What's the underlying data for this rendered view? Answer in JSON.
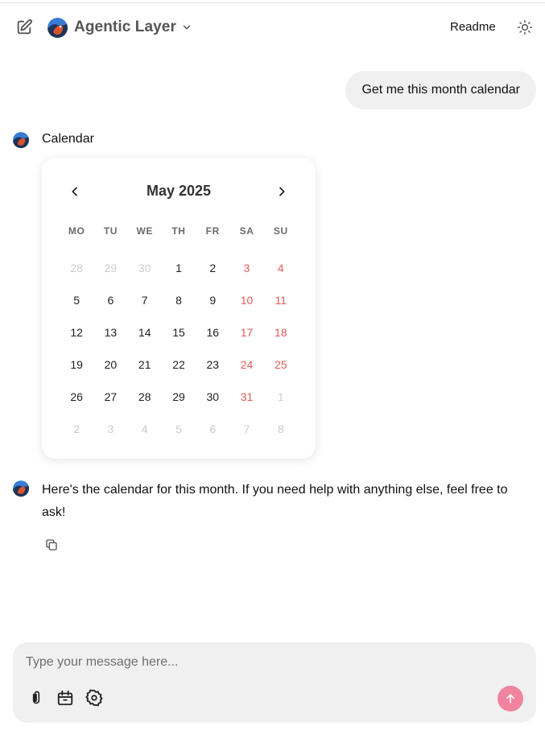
{
  "header": {
    "agent_name": "Agentic Layer",
    "readme_label": "Readme"
  },
  "conversation": {
    "user_message": "Get me this month calendar",
    "assistant_title": "Calendar",
    "assistant_reply": "Here's the calendar for this month. If you need help with anything else, feel free to ask!"
  },
  "calendar": {
    "month_label": "May 2025",
    "weekdays": [
      "MO",
      "TU",
      "WE",
      "TH",
      "FR",
      "SA",
      "SU"
    ],
    "weeks": [
      [
        {
          "d": "28",
          "m": true
        },
        {
          "d": "29",
          "m": true
        },
        {
          "d": "30",
          "m": true
        },
        {
          "d": "1"
        },
        {
          "d": "2"
        },
        {
          "d": "3",
          "w": true
        },
        {
          "d": "4",
          "w": true
        }
      ],
      [
        {
          "d": "5"
        },
        {
          "d": "6"
        },
        {
          "d": "7"
        },
        {
          "d": "8"
        },
        {
          "d": "9"
        },
        {
          "d": "10",
          "w": true
        },
        {
          "d": "11",
          "w": true
        }
      ],
      [
        {
          "d": "12"
        },
        {
          "d": "13"
        },
        {
          "d": "14"
        },
        {
          "d": "15"
        },
        {
          "d": "16"
        },
        {
          "d": "17",
          "w": true
        },
        {
          "d": "18",
          "w": true
        }
      ],
      [
        {
          "d": "19"
        },
        {
          "d": "20"
        },
        {
          "d": "21"
        },
        {
          "d": "22"
        },
        {
          "d": "23"
        },
        {
          "d": "24",
          "w": true
        },
        {
          "d": "25",
          "w": true
        }
      ],
      [
        {
          "d": "26"
        },
        {
          "d": "27"
        },
        {
          "d": "28"
        },
        {
          "d": "29"
        },
        {
          "d": "30"
        },
        {
          "d": "31",
          "w": true
        },
        {
          "d": "1",
          "m": true
        }
      ],
      [
        {
          "d": "2",
          "m": true
        },
        {
          "d": "3",
          "m": true
        },
        {
          "d": "4",
          "m": true
        },
        {
          "d": "5",
          "m": true
        },
        {
          "d": "6",
          "m": true
        },
        {
          "d": "7",
          "m": true
        },
        {
          "d": "8",
          "m": true
        }
      ]
    ]
  },
  "composer": {
    "placeholder": "Type your message here..."
  },
  "icons": {
    "new_chat": "edit-icon",
    "agent_menu": "chevron-down-icon",
    "theme": "sun-icon",
    "calendar_prev": "chevron-left-icon",
    "calendar_next": "chevron-right-icon",
    "copy": "copy-icon",
    "attach": "paperclip-icon",
    "tools": "calendar-tool-icon",
    "settings": "gear-icon",
    "send": "arrow-up-icon"
  },
  "colors": {
    "weekend": "#e35a5a",
    "muted_day": "#c9ccd1",
    "send_button": "#f0849e",
    "bubble": "#f0f0f0"
  }
}
